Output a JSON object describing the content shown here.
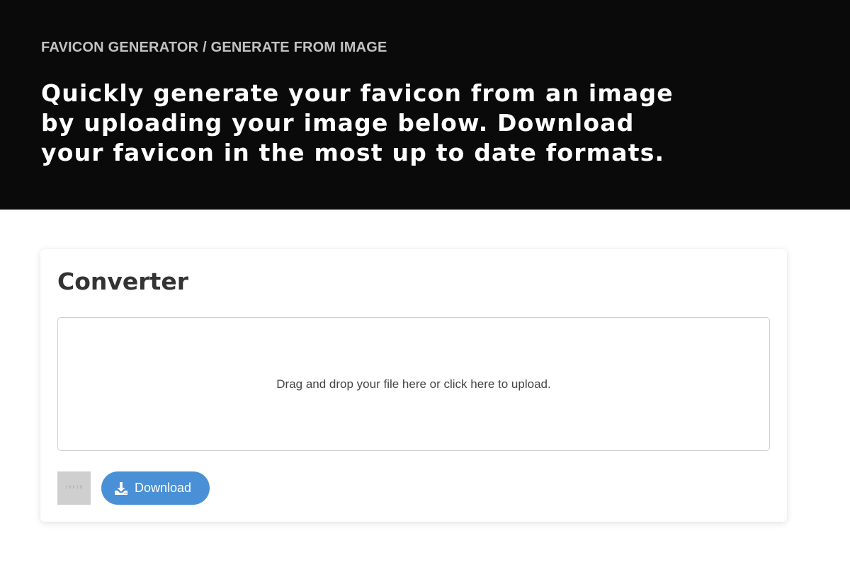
{
  "header": {
    "breadcrumb": "FAVICON GENERATOR / GENERATE FROM IMAGE",
    "headline": "Quickly generate your favicon from an image by uploading your image below. Download your favicon in the most up to date formats."
  },
  "converter": {
    "title": "Converter",
    "dropzone_text": "Drag and drop your file here or click here to upload.",
    "preview_text": "16×16",
    "download_label": "Download",
    "download_icon": "download-icon"
  },
  "colors": {
    "hero_background": "#0a0a0a",
    "button_accent": "#4a90d6",
    "preview_background": "#cfcfcf"
  }
}
